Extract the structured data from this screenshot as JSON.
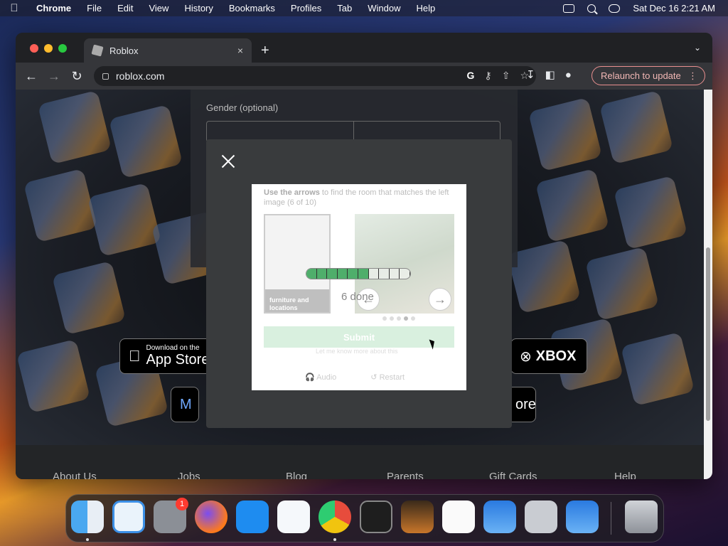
{
  "menubar": {
    "apple": "",
    "app": "Chrome",
    "items": [
      "File",
      "Edit",
      "View",
      "History",
      "Bookmarks",
      "Profiles",
      "Tab",
      "Window",
      "Help"
    ],
    "clock": "Sat Dec 16  2:21 AM"
  },
  "browser": {
    "tab_title": "Roblox",
    "tab_close": "×",
    "new_tab": "+",
    "tab_menu": "⌄",
    "url": "roblox.com",
    "relaunch_label": "Relaunch to update",
    "relaunch_more": "⋮"
  },
  "page": {
    "gender_label": "Gender (optional)",
    "app_store_small": "Download on the",
    "app_store_big": "App Store",
    "xbox_label": "XBOX",
    "meta_label": "M",
    "store_label": "ore",
    "footer_links": [
      "About Us",
      "Jobs",
      "Blog",
      "Parents",
      "Gift Cards",
      "Help"
    ]
  },
  "captcha": {
    "instruction_bold": "Use the arrows",
    "instruction_rest": " to find the room that matches the left image (6 of 10)",
    "ref_caption": "furniture and locations",
    "progress_done": 6,
    "progress_total": 10,
    "done_text": "6 done",
    "submit_label": "Submit",
    "footer_small": "Let me know more about this",
    "audio_label": "Audio",
    "restart_label": "Restart",
    "prev_arrow": "←",
    "next_arrow": "→"
  },
  "dock": {
    "badge_count": "1",
    "apps": [
      "finder",
      "safari",
      "system-settings",
      "firefox",
      "app-store",
      "vscode",
      "chrome",
      "terminal",
      "garageband",
      "textedit",
      "weather",
      "launchpad",
      "weather-2",
      "trash"
    ]
  }
}
